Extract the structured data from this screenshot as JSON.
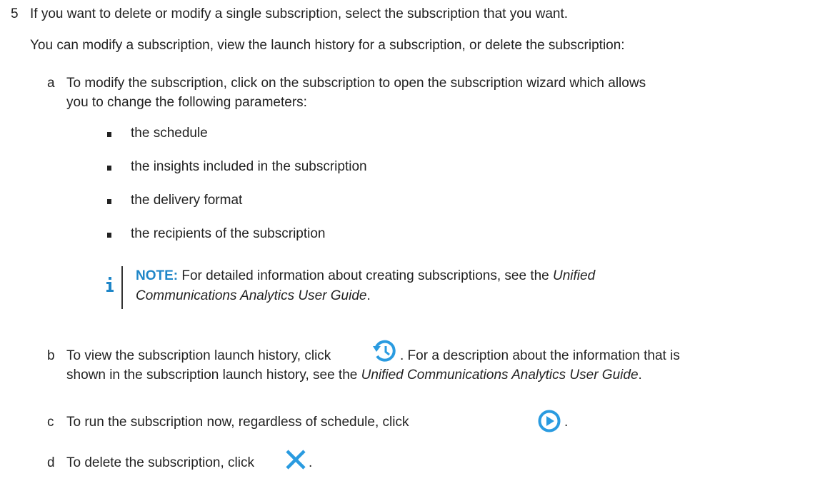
{
  "step": {
    "number": "5",
    "text": "If you want to delete or modify a single subscription, select the subscription that you want.",
    "intro": "You can modify a subscription, view the launch history for a subscription, or delete the subscription:"
  },
  "substeps": {
    "a": {
      "letter": "a",
      "line1": "To modify the subscription, click on the subscription to open the subscription wizard which allows",
      "line2": "you to change the following parameters:",
      "bullets": [
        "the schedule",
        "the insights included in the subscription",
        "the delivery format",
        "the recipients of the subscription"
      ]
    },
    "b": {
      "letter": "b",
      "before_icon": "To view the subscription launch history, click",
      "after_icon": ". For a description about the information that is",
      "line2_prefix": "shown in the subscription launch history, see the ",
      "line2_italic": "Unified Communications Analytics User Guide",
      "line2_suffix": "."
    },
    "c": {
      "letter": "c",
      "before_icon": "To run the subscription now, regardless of schedule, click",
      "after_icon": "."
    },
    "d": {
      "letter": "d",
      "before_icon": "To delete the subscription, click",
      "after_icon": "."
    }
  },
  "note": {
    "label": "NOTE:",
    "text_before": " For detailed information about creating subscriptions, see the ",
    "italic_1": "Unified",
    "italic_2": "Communications Analytics User Guide",
    "text_after": "."
  },
  "icons": {
    "note": "info-icon",
    "history": "history-icon",
    "run": "play-circle-icon",
    "delete": "close-icon"
  },
  "colors": {
    "accent": "#1f86c8",
    "icon_blue": "#2a9be0",
    "text": "#222222"
  }
}
